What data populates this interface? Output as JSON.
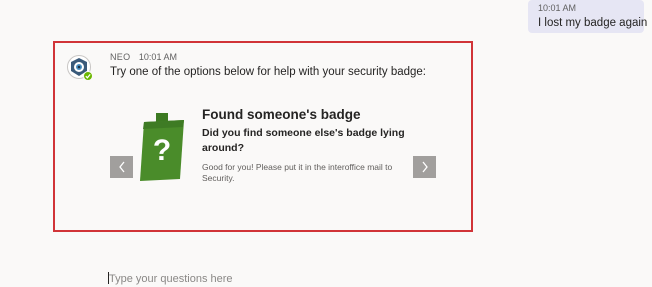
{
  "user_message": {
    "time": "10:01 AM",
    "text": "I lost my badge again"
  },
  "bot_message": {
    "sender": "NEO",
    "time": "10:01 AM",
    "intro": "Try one of the options below for help with your security badge:",
    "avatar_icon": "shield-eye-icon",
    "presence_icon": "check-icon",
    "card": {
      "title": "Found someone's badge",
      "subtitle": "Did you find someone else's badge lying around?",
      "body": "Good for you! Please put it in the interoffice mail to Security.",
      "image_icon": "badge-question-icon"
    }
  },
  "composer": {
    "placeholder": "Type your questions here"
  },
  "colors": {
    "highlight_border": "#d13438",
    "user_bubble": "#e6e6f4",
    "badge_green": "#4a8c2a",
    "nav_button": "#a19f9d"
  }
}
